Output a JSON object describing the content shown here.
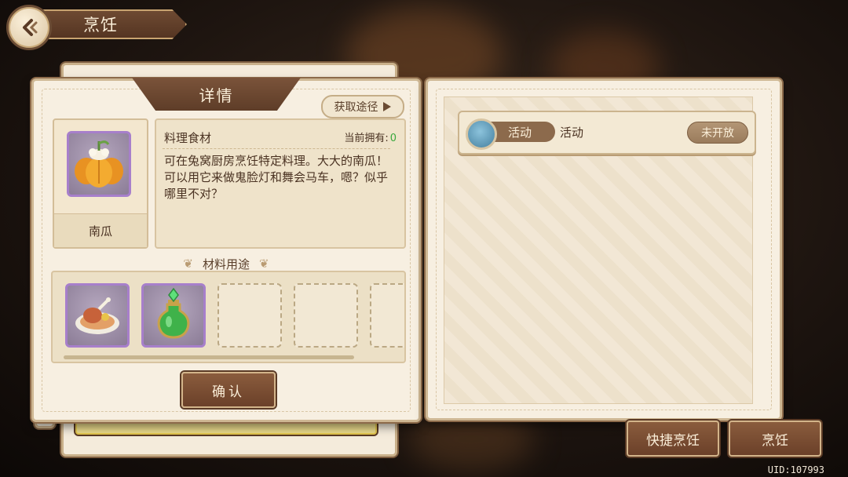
{
  "header": {
    "title": "烹饪"
  },
  "detail": {
    "tab_label": "详情",
    "source_button": "获取途径",
    "item_name": "南瓜",
    "category": "料理食材",
    "owned_label": "当前拥有:",
    "owned_value": "0",
    "description": "可在兔窝厨房烹饪特定料理。大大的南瓜！可以用它来做鬼脸灯和舞会马车，嗯？似乎哪里不对？",
    "usage_title": "材料用途",
    "confirm_label": "确认"
  },
  "activity": {
    "tag": "活动",
    "name": "活动",
    "status": "未开放"
  },
  "actions": {
    "quick_cook": "快捷烹饪",
    "cook": "烹饪"
  },
  "footer": {
    "uid": "UID:107993"
  }
}
